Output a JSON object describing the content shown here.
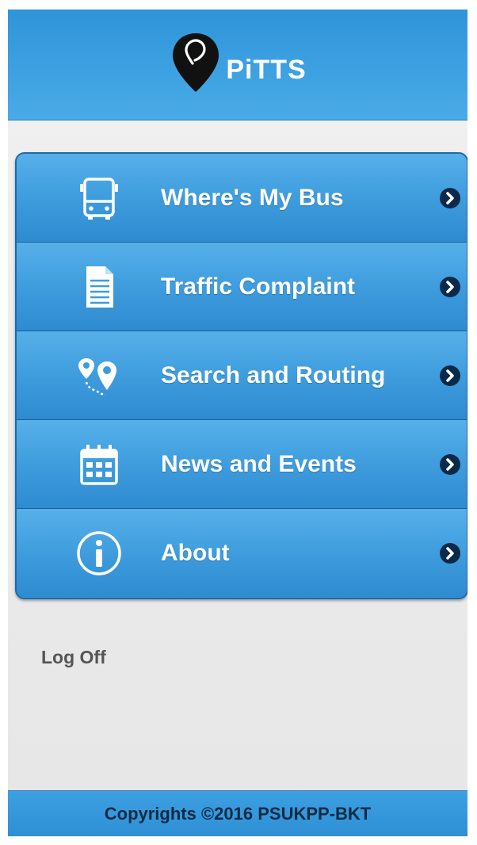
{
  "app": {
    "title": "PiTTS",
    "logo_icon": "map-pin-icon"
  },
  "menu": {
    "items": [
      {
        "label": "Where's My Bus",
        "icon": "bus-icon"
      },
      {
        "label": "Traffic Complaint",
        "icon": "document-icon"
      },
      {
        "label": "Search and Routing",
        "icon": "route-icon"
      },
      {
        "label": "News and Events",
        "icon": "calendar-icon"
      },
      {
        "label": "About",
        "icon": "info-icon"
      }
    ],
    "chevron_icon": "chevron-right-icon"
  },
  "logoff_label": "Log Off",
  "footer": {
    "text": "Copyrights ©2016 PSUKPP-BKT"
  },
  "colors": {
    "header_blue": "#3ea2e2",
    "menu_blue": "#3d9bdc",
    "menu_border": "#1d6aa8",
    "background": "#ececec"
  }
}
